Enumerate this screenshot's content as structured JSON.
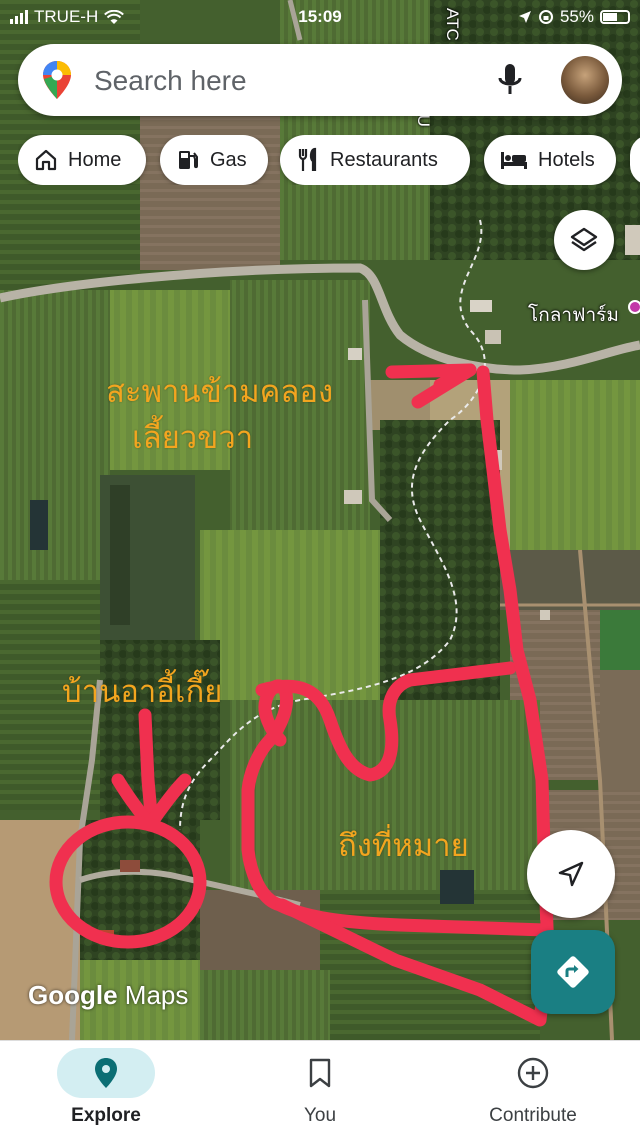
{
  "status_bar": {
    "carrier": "TRUE-H",
    "time": "15:09",
    "battery": "55%",
    "icons": [
      "signal-bars-icon",
      "wifi-icon",
      "location-arrow-icon",
      "rotation-lock-icon",
      "battery-icon"
    ]
  },
  "search": {
    "placeholder": "Search here",
    "icons": [
      "maps-pin-logo-icon",
      "microphone-icon",
      "avatar"
    ]
  },
  "chips": [
    {
      "label": "Home",
      "icon": "home-icon"
    },
    {
      "label": "Gas",
      "icon": "gas-pump-icon"
    },
    {
      "label": "Restaurants",
      "icon": "fork-knife-icon"
    },
    {
      "label": "Hotels",
      "icon": "bed-icon"
    }
  ],
  "map": {
    "place_label": "โกลาฟาร์ม",
    "road_label": "ABU",
    "road_label_2": "ATC",
    "annotations": {
      "bridge_line1": "สะพานข้ามคลอง",
      "bridge_line2": "เลี้ยวขวา",
      "home": "บ้านอาอี้เกี๊ย",
      "destination": "ถึงที่หมาย"
    },
    "annotation_color": "#f3a51f",
    "route_color": "#f0304f",
    "watermark_google": "Google",
    "watermark_maps": "Maps"
  },
  "controls": {
    "icons": [
      "layers-icon",
      "my-location-icon",
      "directions-icon"
    ],
    "directions_color": "#1a7f83"
  },
  "bottom_nav": [
    {
      "label": "Explore",
      "icon": "location-pin-icon",
      "active": true
    },
    {
      "label": "You",
      "icon": "bookmark-icon",
      "active": false
    },
    {
      "label": "Contribute",
      "icon": "plus-circle-icon",
      "active": false
    }
  ]
}
